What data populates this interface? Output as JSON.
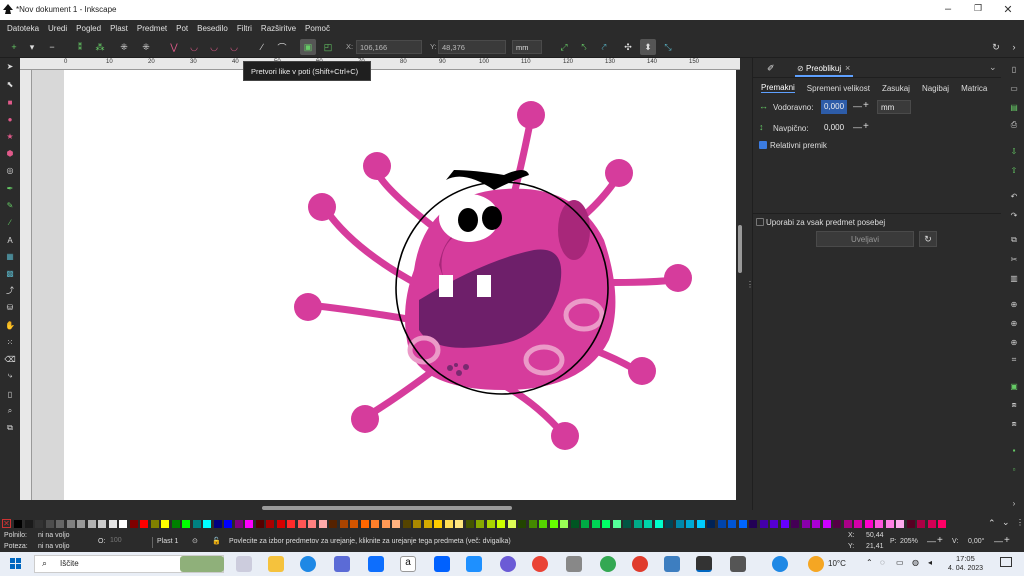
{
  "window": {
    "title": "*Nov dokument 1 - Inkscape",
    "minimize": "–",
    "maximize": "❐",
    "close": "✕"
  },
  "menu": [
    "Datoteka",
    "Uredi",
    "Pogled",
    "Plast",
    "Predmet",
    "Pot",
    "Besedilo",
    "Filtri",
    "Razširitve",
    "Pomoč"
  ],
  "toolcontrols": {
    "x_label": "X:",
    "x_value": "106,166",
    "y_label": "Y:",
    "y_value": "48,376",
    "unit": "mm"
  },
  "tooltip": "Pretvori like v poti (Shift+Ctrl+C)",
  "ruler_labels": [
    "0",
    "10",
    "20",
    "30",
    "40",
    "50",
    "60",
    "70",
    "80",
    "90",
    "100",
    "110",
    "120",
    "130",
    "140",
    "150"
  ],
  "dock": {
    "tab_label": "Preoblikuj",
    "tab_close": "×",
    "subtabs": [
      "Premakni",
      "Spremeni velikost",
      "Zasukaj",
      "Nagibaj",
      "Matrica"
    ],
    "horizontal_label": "Vodoravno:",
    "horizontal_value": "0,000",
    "vertical_label": "Navpično:",
    "vertical_value": "0,000",
    "unit": "mm",
    "relative_label": "Relativni premik",
    "relative_checked": true,
    "separate_label": "Uporabi za vsak predmet posebej",
    "separate_checked": false,
    "apply_label": "Uveljavi",
    "minus": "—",
    "plus": "+"
  },
  "palette": [
    "#000000",
    "#1a1a1a",
    "#333333",
    "#4d4d4d",
    "#666666",
    "#808080",
    "#999999",
    "#b3b3b3",
    "#cccccc",
    "#e6e6e6",
    "#ffffff",
    "#800000",
    "#ff0000",
    "#808000",
    "#ffff00",
    "#008000",
    "#00ff00",
    "#008080",
    "#00ffff",
    "#000080",
    "#0000ff",
    "#800080",
    "#ff00ff",
    "#550000",
    "#aa0000",
    "#d40000",
    "#ff2a2a",
    "#ff5555",
    "#ff8080",
    "#ffaaaa",
    "#552200",
    "#aa4400",
    "#d45500",
    "#ff6600",
    "#ff7f2a",
    "#ff9955",
    "#ffb380",
    "#554400",
    "#aa8800",
    "#d4aa00",
    "#ffcc00",
    "#ffdd55",
    "#ffe680",
    "#445500",
    "#88aa00",
    "#aad400",
    "#ccff00",
    "#ddff55",
    "#224400",
    "#448800",
    "#55d400",
    "#66ff00",
    "#99ff55",
    "#005522",
    "#00aa44",
    "#00d455",
    "#00ff66",
    "#55ff99",
    "#005544",
    "#00aa88",
    "#00d4aa",
    "#00ffcc",
    "#004455",
    "#0088aa",
    "#00aad4",
    "#00ccff",
    "#002255",
    "#0044aa",
    "#0055d4",
    "#0066ff",
    "#220055",
    "#4400aa",
    "#5500d4",
    "#6600ff",
    "#440055",
    "#8800aa",
    "#aa00d4",
    "#cc00ff",
    "#550044",
    "#aa0088",
    "#d400aa",
    "#ff00cc",
    "#ff55dd",
    "#ff80e5",
    "#ffaaee",
    "#550022",
    "#aa0044",
    "#d40055",
    "#ff0066"
  ],
  "status": {
    "fill_label": "Polnilo:",
    "fill_value": "ni na voljo",
    "stroke_label": "Poteza:",
    "stroke_value": "ni na voljo",
    "opacity_label": "O:",
    "opacity_value": "100",
    "layer": "Plast 1",
    "message": "Povlecite za izbor predmetov za urejanje, kliknite za urejanje tega predmeta (več: dvigalka)",
    "x_label": "X:",
    "x_value": "50,44",
    "y_label": "Y:",
    "y_value": "21,41",
    "zoom_label": "P:",
    "zoom_value": "205%",
    "rotation_label": "V:",
    "rotation_value": "0,00°"
  },
  "taskbar": {
    "search": "Iščite",
    "weather": "10°C",
    "time": "17:05",
    "date": "4. 04. 2023"
  },
  "colors": {
    "virus_body": "#d63c9c",
    "virus_dark": "#a8277a",
    "mouth": "#6e1f6a",
    "spot": "#eb9ac8"
  }
}
